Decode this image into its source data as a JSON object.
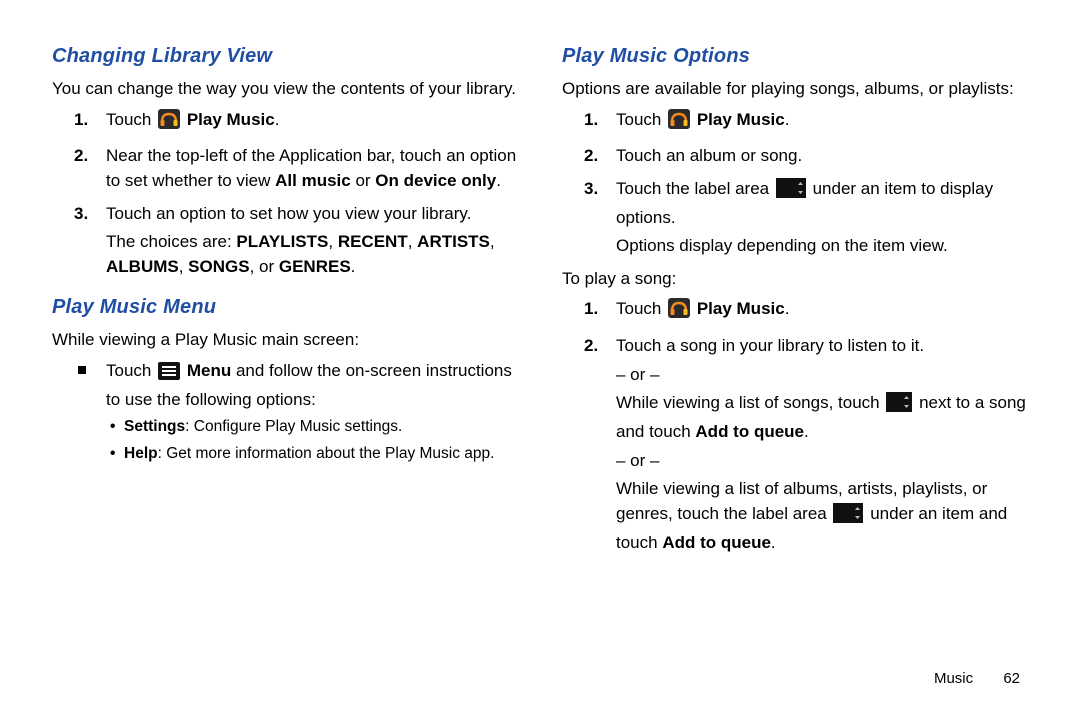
{
  "left": {
    "heading1": "Changing Library View",
    "intro1": "You can change the way you view the contents of your library.",
    "step1_touch": "Touch ",
    "step1_appname": " Play Music",
    "step2a": "Near the top-left of the Application bar, touch an option to set whether to view ",
    "step2_allmusic": "All music",
    "step2_or": " or ",
    "step2_ondevice": "On device only",
    "step3": "Touch an option to set how you view your library.",
    "step3_sub_a": "The choices are: ",
    "step3_sub_b": "PLAYLISTS",
    "step3_sub_c": "RECENT",
    "step3_sub_d": "ARTISTS",
    "step3_sub_e": "ALBUMS",
    "step3_sub_f": "SONGS",
    "step3_sub_g": "GENRES",
    "comma": ", ",
    "comma_or": ", or ",
    "period": ".",
    "heading2": "Play Music Menu",
    "intro2": "While viewing a Play Music main screen:",
    "menu_touch": "Touch ",
    "menu_label": " Menu",
    "menu_rest": " and follow the on-screen instructions to use the following options:",
    "opt1_label": "Settings",
    "opt1_desc": ": Configure Play Music settings.",
    "opt2_label": "Help",
    "opt2_desc": ": Get  more information about the Play Music app."
  },
  "right": {
    "heading1": "Play Music Options",
    "intro1": "Options are available for playing songs, albums, or playlists:",
    "step1_touch": "Touch ",
    "step1_appname": " Play Music",
    "step2": "Touch an album or song.",
    "step3a": "Touch the label area ",
    "step3b": " under an item to display options.",
    "step3_sub": "Options display depending on the item view.",
    "toplay": "To play a song:",
    "p1_touch": "Touch ",
    "p1_appname": " Play Music",
    "p2": "Touch a song in your library to listen to it.",
    "or": "– or –",
    "p2_alt1a": "While viewing a list of songs, touch ",
    "p2_alt1b": " next to a song and touch ",
    "p2_alt1_add": "Add to queue",
    "p2_alt2a": "While viewing a list of albums, artists, playlists, or genres, touch the label area ",
    "p2_alt2b": " under an item and touch ",
    "p2_alt2_add": "Add to queue"
  },
  "footer": {
    "section": "Music",
    "page": "62"
  },
  "period": "."
}
